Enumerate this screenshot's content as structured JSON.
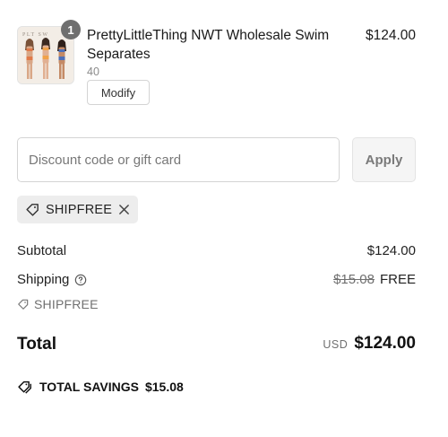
{
  "product": {
    "quantity": "1",
    "name": "PrettyLittleThing NWT Wholesale Swim Separates",
    "variant": "40",
    "modify_label": "Modify",
    "price": "$124.00",
    "image_text": "PLT SW"
  },
  "discount": {
    "placeholder": "Discount code or gift card",
    "value": "",
    "apply_label": "Apply",
    "applied_code": "SHIPFREE"
  },
  "summary": {
    "subtotal_label": "Subtotal",
    "subtotal_value": "$124.00",
    "shipping_label": "Shipping",
    "shipping_original": "$15.08",
    "shipping_value": "FREE",
    "shipping_discount_code": "SHIPFREE",
    "total_label": "Total",
    "currency": "USD",
    "total_value": "$124.00",
    "savings_label": "TOTAL SAVINGS",
    "savings_value": "$15.08"
  },
  "icons": {
    "tag": "tag-icon",
    "close": "close-icon",
    "help": "help-circle-icon",
    "savings": "double-tag-icon"
  }
}
